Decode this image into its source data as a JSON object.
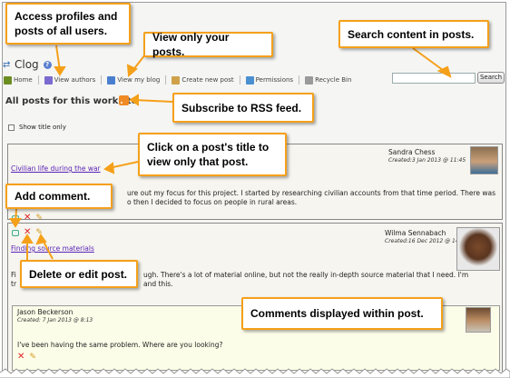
{
  "tool": {
    "title": "Clog",
    "help_icon": "help-icon",
    "reset_icon": "reset-icon"
  },
  "toolbar": {
    "items": [
      {
        "label": "Home",
        "icon": "home-icon",
        "color": "#6b8e23"
      },
      {
        "label": "View authors",
        "icon": "authors-icon",
        "color": "#7a6bd0"
      },
      {
        "label": "View my blog",
        "icon": "blog-icon",
        "color": "#4a7fd0"
      },
      {
        "label": "Create new post",
        "icon": "new-post-icon",
        "color": "#cfa14a"
      },
      {
        "label": "Permissions",
        "icon": "permissions-icon",
        "color": "#4a90d0"
      },
      {
        "label": "Recycle Bin",
        "icon": "recycle-bin-icon",
        "color": "#9a9a9a"
      }
    ]
  },
  "search": {
    "button_label": "Search",
    "value": ""
  },
  "section": {
    "title": "All posts for this worksite",
    "rss_icon": "rss-icon"
  },
  "show_title_only": {
    "label": "Show title only",
    "checked": false
  },
  "posts": [
    {
      "title": "Civilian life during the war",
      "author": "Sandra Chess",
      "created": "Created:3 Jan 2013 @ 11:45",
      "body_line1": "ure out my focus for this project. I started by researching civilian accounts from that time period. There was",
      "body_line2": "o then I decided to focus on people in rural areas."
    },
    {
      "title": "Finding source materials",
      "author": "Wilma Sennabach",
      "created": "Created:16 Dec 2012 @ 14:42",
      "body_pre1": "Fi",
      "body_line1": "ugh. There's a lot of material online, but not the really in-depth source material that I need. I'm",
      "body_pre2": "tr",
      "body_line2": "and this."
    }
  ],
  "comment": {
    "author": "Jason Beckerson",
    "created": "Created: 7 Jan 2013 @ 8:13",
    "text": "I've been having the same problem. Where are you looking?"
  },
  "callouts": {
    "access_profiles": "Access profiles and posts of all users.",
    "view_only_posts": "View only your posts.",
    "search_content": "Search content in posts.",
    "subscribe_rss": "Subscribe to RSS feed.",
    "click_title": "Click on a post's title to view only that post.",
    "add_comment": "Add comment.",
    "delete_edit": "Delete or edit post.",
    "comments_within": "Comments displayed within post."
  },
  "colors": {
    "callout_border": "#f5a01a",
    "link": "#5b24b8",
    "delete": "#dd2222",
    "edit": "#d39b1a",
    "rss": "#f08a24"
  }
}
